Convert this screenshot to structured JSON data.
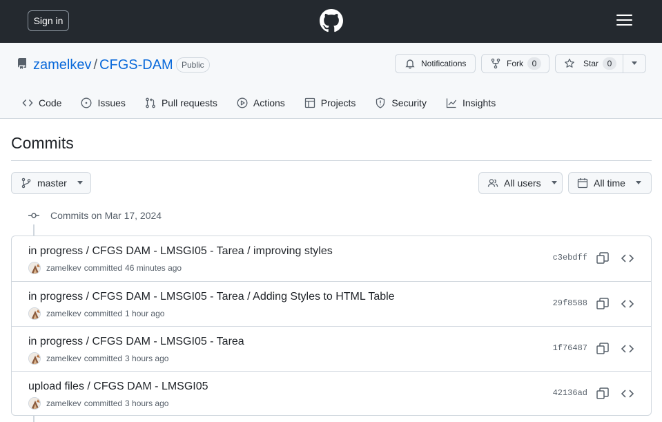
{
  "header": {
    "signin_label": "Sign in",
    "logo_icon": "github-mark-icon",
    "menu_icon": "hamburger-icon"
  },
  "repo": {
    "owner": "zamelkev",
    "separator": "/",
    "name": "CFGS-DAM",
    "visibility": "Public",
    "notifications_label": "Notifications",
    "fork_label": "Fork",
    "fork_count": "0",
    "star_label": "Star",
    "star_count": "0"
  },
  "tabs": [
    {
      "label": "Code",
      "icon": "code-icon"
    },
    {
      "label": "Issues",
      "icon": "issue-opened-icon"
    },
    {
      "label": "Pull requests",
      "icon": "git-pull-request-icon"
    },
    {
      "label": "Actions",
      "icon": "play-icon"
    },
    {
      "label": "Projects",
      "icon": "table-icon"
    },
    {
      "label": "Security",
      "icon": "shield-icon"
    },
    {
      "label": "Insights",
      "icon": "graph-icon"
    }
  ],
  "page": {
    "title": "Commits",
    "branch": "master",
    "users_filter": "All users",
    "time_filter": "All time",
    "date_heading": "Commits on Mar 17, 2024"
  },
  "commits": [
    {
      "message": "in progress / CFGS DAM - LMSGI05 - Tarea / improving styles",
      "author": "zamelkev",
      "action": "committed",
      "time": "46 minutes ago",
      "sha": "c3ebdff"
    },
    {
      "message": "in progress / CFGS DAM - LMSGI05 - Tarea / Adding Styles to HTML Table",
      "author": "zamelkev",
      "action": "committed",
      "time": "1 hour ago",
      "sha": "29f8588"
    },
    {
      "message": "in progress / CFGS DAM - LMSGI05 - Tarea",
      "author": "zamelkev",
      "action": "committed",
      "time": "3 hours ago",
      "sha": "1f76487"
    },
    {
      "message": "upload files / CFGS DAM - LMSGI05",
      "author": "zamelkev",
      "action": "committed",
      "time": "3 hours ago",
      "sha": "42136ad"
    }
  ],
  "colors": {
    "header_bg": "#24292f",
    "link": "#0969da",
    "border": "#d0d7de",
    "muted": "#57606a"
  }
}
